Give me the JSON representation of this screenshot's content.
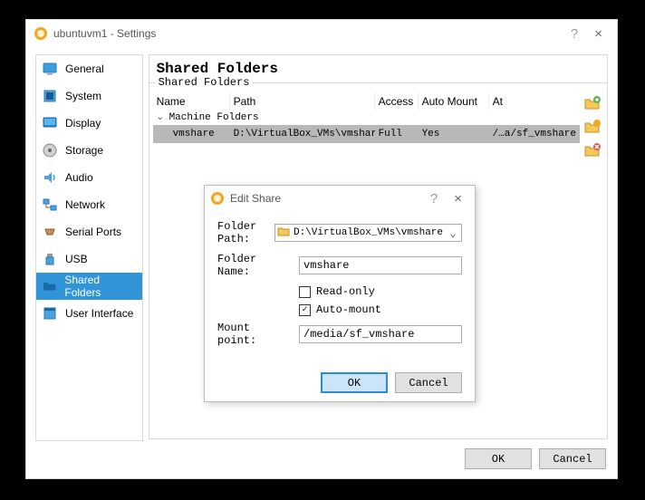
{
  "window": {
    "title": "ubuntuvm1 - Settings",
    "help": "?",
    "close": "×"
  },
  "sidebar": {
    "items": [
      {
        "label": "General"
      },
      {
        "label": "System"
      },
      {
        "label": "Display"
      },
      {
        "label": "Storage"
      },
      {
        "label": "Audio"
      },
      {
        "label": "Network"
      },
      {
        "label": "Serial Ports"
      },
      {
        "label": "USB"
      },
      {
        "label": "Shared Folders"
      },
      {
        "label": "User Interface"
      }
    ]
  },
  "page": {
    "title": "Shared Folders",
    "group_label": "Shared Folders"
  },
  "table": {
    "headers": {
      "name": "Name",
      "path": "Path",
      "access": "Access",
      "auto": "Auto Mount",
      "at": "At"
    },
    "group": "Machine Folders",
    "row": {
      "name": "vmshare",
      "path": "D:\\VirtualBox_VMs\\vmshare",
      "access": "Full",
      "auto": "Yes",
      "at": "/…a/sf_vmshare"
    }
  },
  "dialog": {
    "title": "Edit Share",
    "folder_path_label": "Folder Path:",
    "folder_path_value": "D:\\VirtualBox_VMs\\vmshare",
    "folder_name_label": "Folder Name:",
    "folder_name_value": "vmshare",
    "readonly_label": "Read-only",
    "automount_label": "Auto-mount",
    "mount_label": "Mount point:",
    "mount_value": "/media/sf_vmshare",
    "ok": "OK",
    "cancel": "Cancel"
  },
  "footer": {
    "ok": "OK",
    "cancel": "Cancel"
  }
}
